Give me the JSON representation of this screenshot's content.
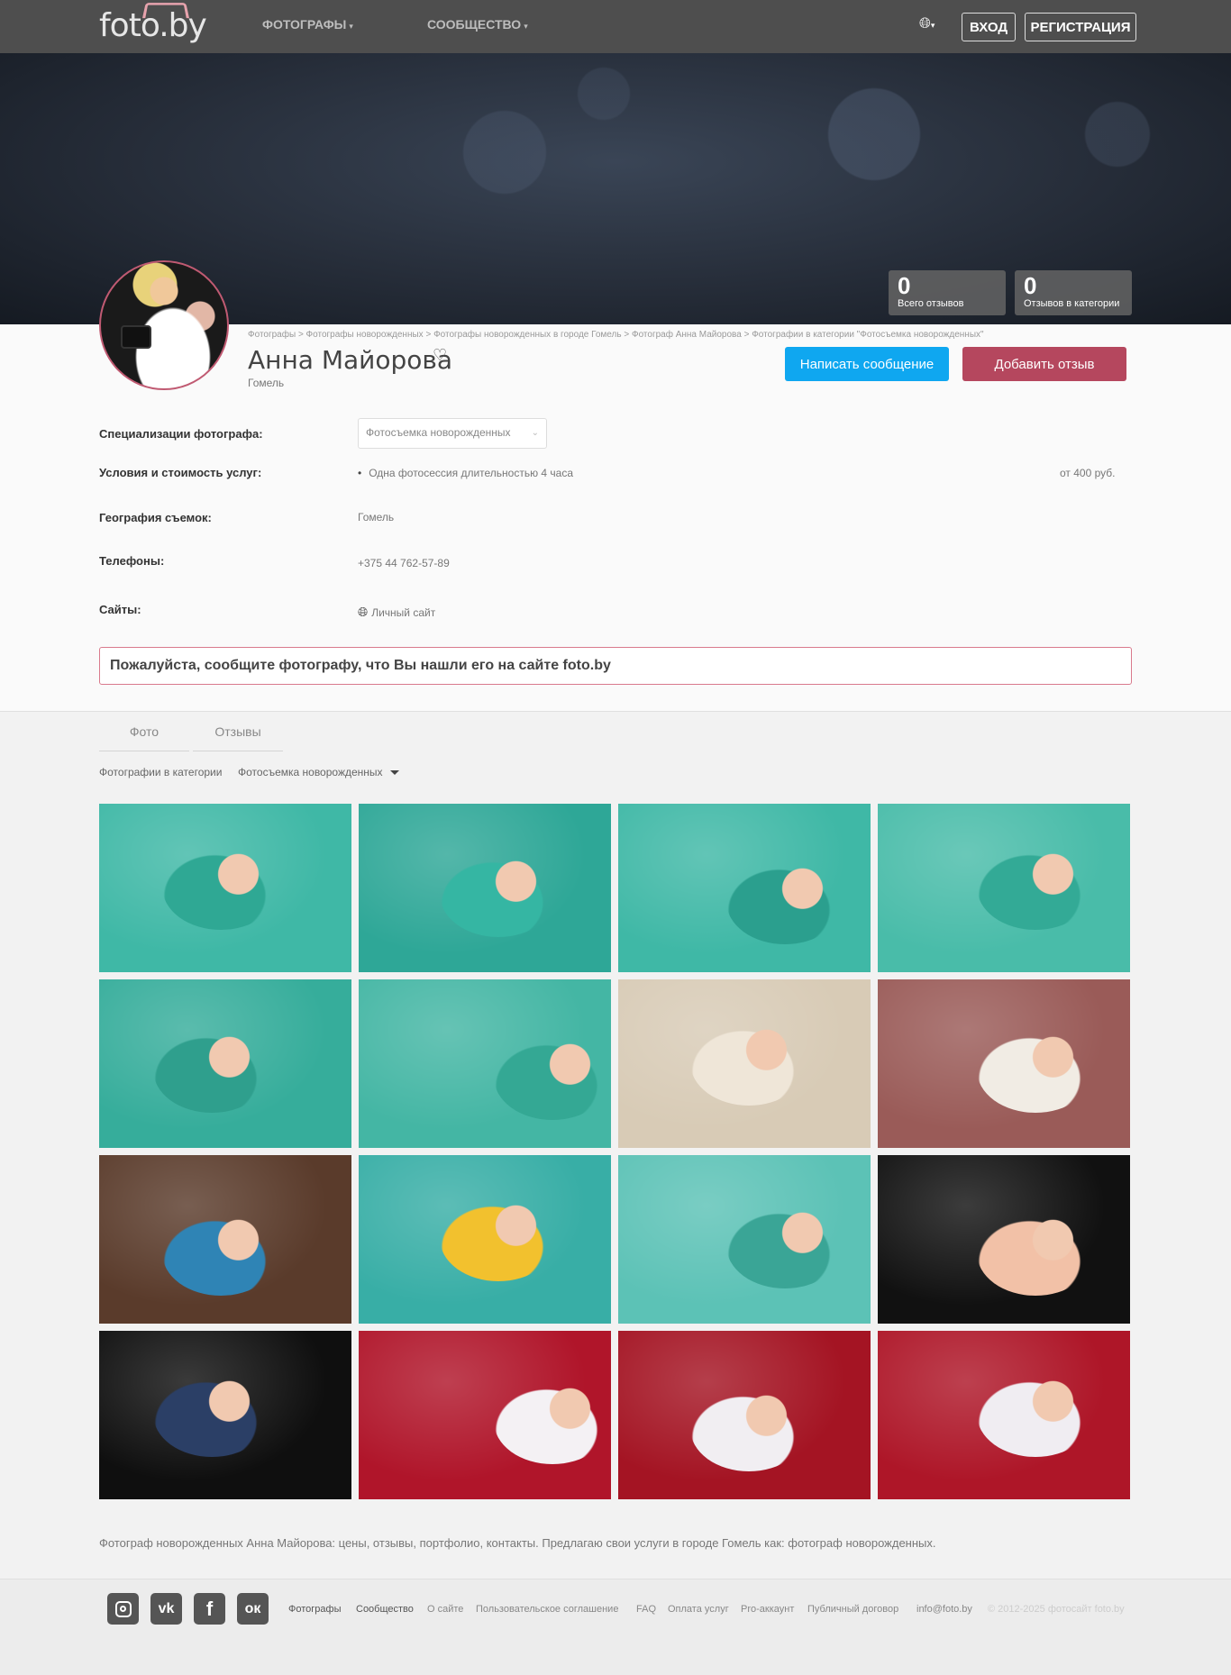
{
  "nav": {
    "logo": "foto.by",
    "photos_label": "ФОТОГРАФЫ",
    "community_label": "СООБЩЕСТВО",
    "login_label": "ВХОД",
    "register_label": "РЕГИСТРАЦИЯ"
  },
  "stats": [
    {
      "value": "0",
      "label": "Всего отзывов"
    },
    {
      "value": "0",
      "label": "Отзывов в категории"
    }
  ],
  "breadcrumb": "Фотографы > Фотографы новорожденных > Фотографы новорожденных в городе Гомель > Фотограф Анна Майорова > Фотографии в категории \"Фотосъемка новорожденных\"",
  "profile": {
    "name": "Анна Майорова",
    "city": "Гомель",
    "message_button": "Написать сообщение",
    "review_button": "Добавить отзыв"
  },
  "details": {
    "spec_label": "Специализации фотографа:",
    "spec_value": "Фотосъемка новорожденных",
    "terms_label": "Условия и стоимость услуг:",
    "terms_item": "Одна фотосессия длительностью 4 часа",
    "terms_price": "от 400 руб.",
    "geo_label": "География съемок:",
    "geo_value": "Гомель",
    "phone_label": "Телефоны:",
    "phone_value": "+375 44 762-57-89",
    "sites_label": "Сайты:",
    "sites_value": "Личный сайт"
  },
  "notice": "Пожалуйста, сообщите фотографу, что Вы нашли его на сайте foto.by",
  "tabs": {
    "photo": "Фото",
    "reviews": "Отзывы"
  },
  "filter": {
    "label": "Фотографии в категории",
    "value": "Фотосъемка новорожденных"
  },
  "photos": [
    {
      "bg": "#3fb8a6",
      "accent": "#2fa894"
    },
    {
      "bg": "#2ea797",
      "accent": "#35b6a3"
    },
    {
      "bg": "#3fb8a6",
      "accent": "#2b9f8e"
    },
    {
      "bg": "#49bca9",
      "accent": "#33aa96"
    },
    {
      "bg": "#36ad9b",
      "accent": "#2f9f8d"
    },
    {
      "bg": "#44b6a4",
      "accent": "#34a894"
    },
    {
      "bg": "#d8cbb6",
      "accent": "#efe6d8"
    },
    {
      "bg": "#9a5b58",
      "accent": "#f1ece4"
    },
    {
      "bg": "#5a3b2b",
      "accent": "#2f84b5"
    },
    {
      "bg": "#38aea6",
      "accent": "#f2c12e"
    },
    {
      "bg": "#5cc2b6",
      "accent": "#3aa596"
    },
    {
      "bg": "#111111",
      "accent": "#f2c1a7"
    },
    {
      "bg": "#0f0f0f",
      "accent": "#2b3f66"
    },
    {
      "bg": "#b0152a",
      "accent": "#f4f1f4"
    },
    {
      "bg": "#a41423",
      "accent": "#f1eef2"
    },
    {
      "bg": "#ae1628",
      "accent": "#f0edf2"
    }
  ],
  "seo_text": "Фотограф новорожденных Анна Майорова: цены, отзывы, портфолио, контакты. Предлагаю свои услуги в городе Гомель как: фотограф новорожденных.",
  "footer": {
    "links": [
      "Фотографы",
      "Сообщество",
      "О сайте",
      "Пользовательское соглашение",
      "FAQ",
      "Оплата услуг",
      "Pro-аккаунт",
      "Публичный договор",
      "info@foto.by"
    ],
    "copyright": "© 2012-2025 фотосайт foto.by",
    "social_icons": [
      "instagram-icon",
      "vk-icon",
      "facebook-icon",
      "odnoklassniki-icon"
    ]
  }
}
